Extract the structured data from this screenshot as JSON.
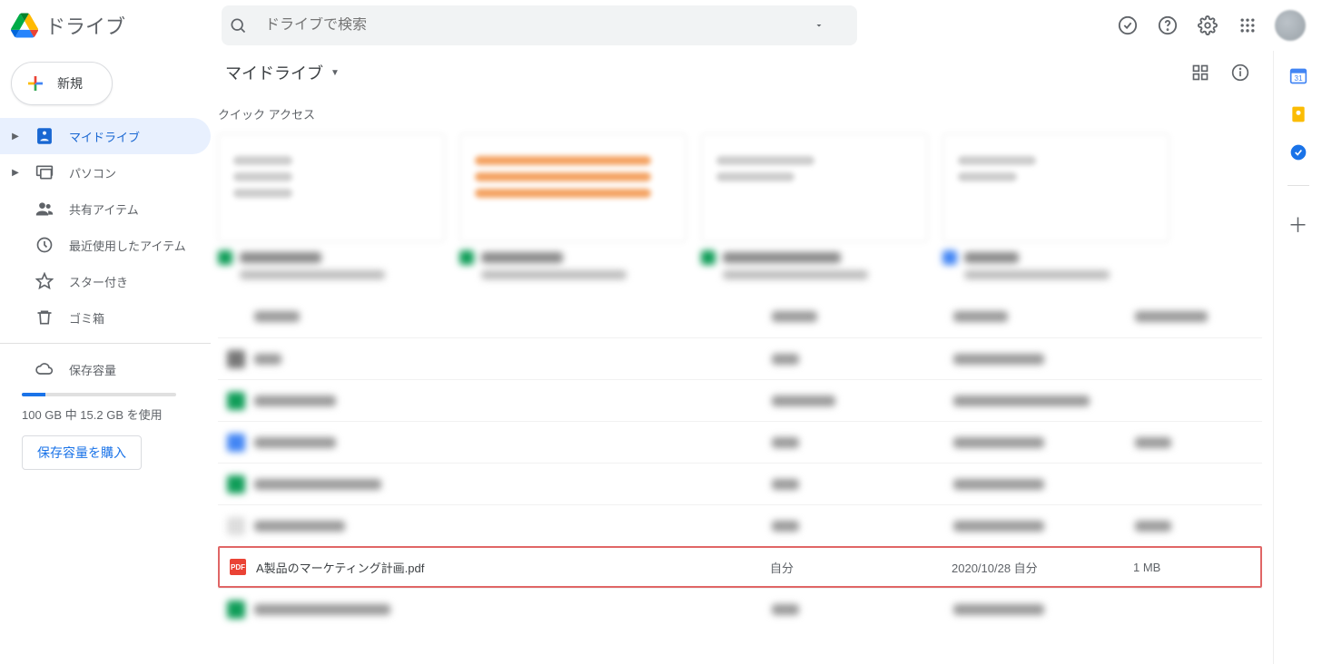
{
  "header": {
    "product_name": "ドライブ",
    "search_placeholder": "ドライブで検索"
  },
  "sidebar": {
    "new_label": "新規",
    "items": [
      {
        "label": "マイドライブ",
        "has_chevron": true,
        "active": true
      },
      {
        "label": "パソコン",
        "has_chevron": true,
        "active": false
      },
      {
        "label": "共有アイテム",
        "has_chevron": false,
        "active": false
      },
      {
        "label": "最近使用したアイテム",
        "has_chevron": false,
        "active": false
      },
      {
        "label": "スター付き",
        "has_chevron": false,
        "active": false
      },
      {
        "label": "ゴミ箱",
        "has_chevron": false,
        "active": false
      }
    ],
    "storage_label": "保存容量",
    "storage_text": "100 GB 中 15.2 GB を使用",
    "buy_label": "保存容量を購入"
  },
  "main": {
    "breadcrumb": "マイドライブ",
    "quick_access_title": "クイック アクセス"
  },
  "file": {
    "name": "A製品のマーケティング計画.pdf",
    "owner": "自分",
    "modified": "2020/10/28 自分",
    "size": "1 MB",
    "pdf_badge": "PDF"
  }
}
